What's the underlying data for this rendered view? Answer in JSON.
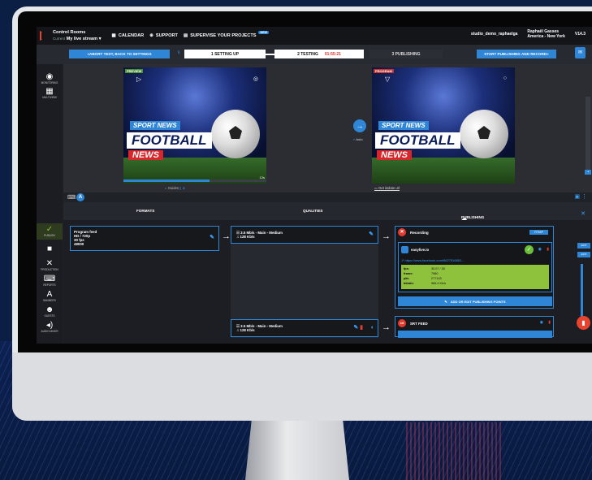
{
  "app": {
    "title": "Control Rooms",
    "subtitle": "Current",
    "stream_name": "My live stream",
    "dropdown_caret": "▾"
  },
  "nav": {
    "calendar": "CALENDAR",
    "support": "SUPPORT",
    "supervise": "SUPERVISE YOUR PROJECTS",
    "supervise_badge": "NEW"
  },
  "user": {
    "studio": "studio_demo_raphaelga",
    "name": "Raphaël Gasses",
    "location": "America - New York",
    "version": "V14.3"
  },
  "steps": {
    "abort": "ABORT TEST, BACK TO SETTINGS",
    "step1": "1  SETTING UP",
    "step2": "2  TESTING",
    "timer": "01:55:21",
    "step3": "3  PUBLISHING",
    "start": "START PUBLISHING AND RECORD"
  },
  "rail": [
    {
      "icon": "gauge-icon",
      "glyph": "◉",
      "label": "MONITORING"
    },
    {
      "icon": "grid-icon",
      "glyph": "▦",
      "label": "MULTIVIEW"
    },
    {
      "icon": "publish-icon",
      "glyph": "✓",
      "label": "PUBLISH"
    },
    {
      "icon": "camera-icon",
      "glyph": "■",
      "label": ""
    },
    {
      "icon": "tools-icon",
      "glyph": "✕",
      "label": "PRODUCTION"
    },
    {
      "icon": "keyboard-icon",
      "glyph": "⌨",
      "label": "REPORTS"
    },
    {
      "icon": "text-icon",
      "glyph": "A",
      "label": "BANNERS"
    },
    {
      "icon": "guests-icon",
      "glyph": "☻",
      "label": "GUESTS"
    },
    {
      "icon": "audio-icon",
      "glyph": "◂)",
      "label": "AUDIO MIXER"
    }
  ],
  "preview": {
    "label_preview": "PREVIEW",
    "label_program": "PROGRAM",
    "line1": "SPORT NEWS",
    "line2": "FOOTBALL",
    "line3": "NEWS",
    "duration": "12s",
    "auto": "Auto",
    "guides": "Guides",
    "iso_link": "Get isolate url"
  },
  "columns": {
    "formats": "FORMATS",
    "qualities": "QUALITIES",
    "publishing": "PUBLISHING POINTS"
  },
  "format_card": {
    "l1": "Program feed",
    "l2": "HD / 720p",
    "l3": "30 fps",
    "l4": "48000"
  },
  "quality1": {
    "l1": "3.5 Mb/s - Main - Medium",
    "l2": "128 Kb/s"
  },
  "quality2": {
    "l1": "3.5 Mb/s - Main - Medium",
    "l2": "128 Kb/s"
  },
  "recording": {
    "title": "Recording",
    "rtmp": "RTMP",
    "target": "easylive.io",
    "link": "https://www.facebook.com/6627516851...",
    "stats": [
      {
        "k": "fps:",
        "v": "30.07 / 30"
      },
      {
        "k": "frame:",
        "v": "7980"
      },
      {
        "k": "pkt:",
        "v": "277143"
      },
      {
        "k": "bitrate:",
        "v": "965.4 Kb/s"
      }
    ],
    "add": "ADD OR EDIT PUBLISHING POINTS"
  },
  "srt": {
    "title": "SRT FEED"
  },
  "side": {
    "b1": "EDIT",
    "b2": "EDIT"
  }
}
